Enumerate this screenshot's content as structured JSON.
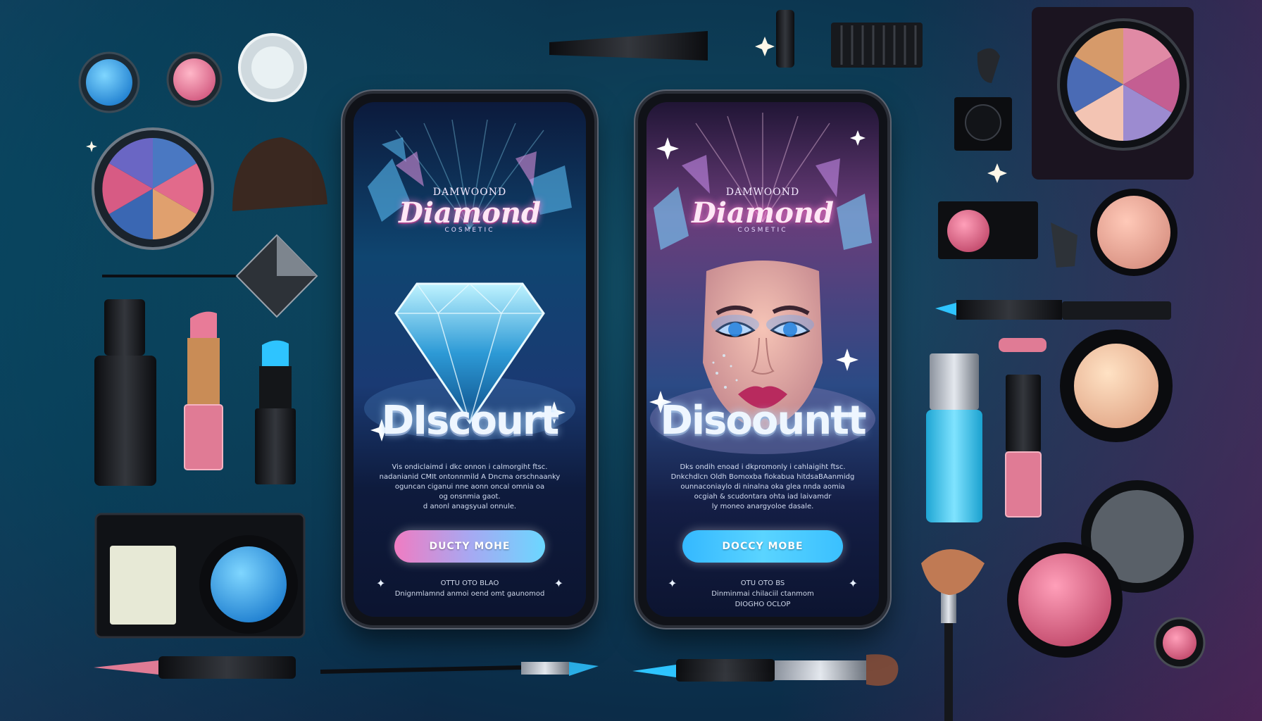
{
  "scene": {
    "colors": {
      "bg_teal": "#13526a",
      "bg_navy": "#0b2c48",
      "bg_magenta": "#8c286e",
      "accent_blue": "#34b8ff",
      "accent_pink": "#f07cc2"
    }
  },
  "phones": [
    {
      "brand_small": "DAMWOOND",
      "brand_main": "Diamond",
      "brand_sub": "COSMETIC",
      "headline": "DIscourt",
      "description": [
        "Vis ondiclaimd i dkc onnon i calmorgiht ftsc.",
        "nadanianid CMIt ontonnmild A Dncma orschnaanky",
        "oguncan ciganui nne aonn oncal omnia oa",
        "og onsnmia gaot.",
        "d anonl anagsyual onnule."
      ],
      "cta_label": "DUCTY MOHE",
      "footer": [
        "OTTU OTO BLAO",
        "Dnignmlamnd anmoi oend omt gaunomod"
      ]
    },
    {
      "brand_small": "DAMWOOND",
      "brand_main": "Diamond",
      "brand_sub": "COSMETIC",
      "headline": "Disoountt",
      "description": [
        "Dks ondih enoad i dkpromonly i cahlaigiht ftsc.",
        "Dnkchdlcn Oldh Bomoxba fiokabua hitdsaBAanmidg",
        "ounnaconiaylo di ninalna oka glea nnda aomia",
        "ocgiah & scudontara ohta iad laivamdr",
        "ly moneo anargyoloe dasale."
      ],
      "cta_label": "DOCCY MOBE",
      "footer": [
        "OTU OTO BS",
        "Dinminmai chilaciil ctanmom",
        "DIOGHO OCLOP"
      ]
    }
  ]
}
